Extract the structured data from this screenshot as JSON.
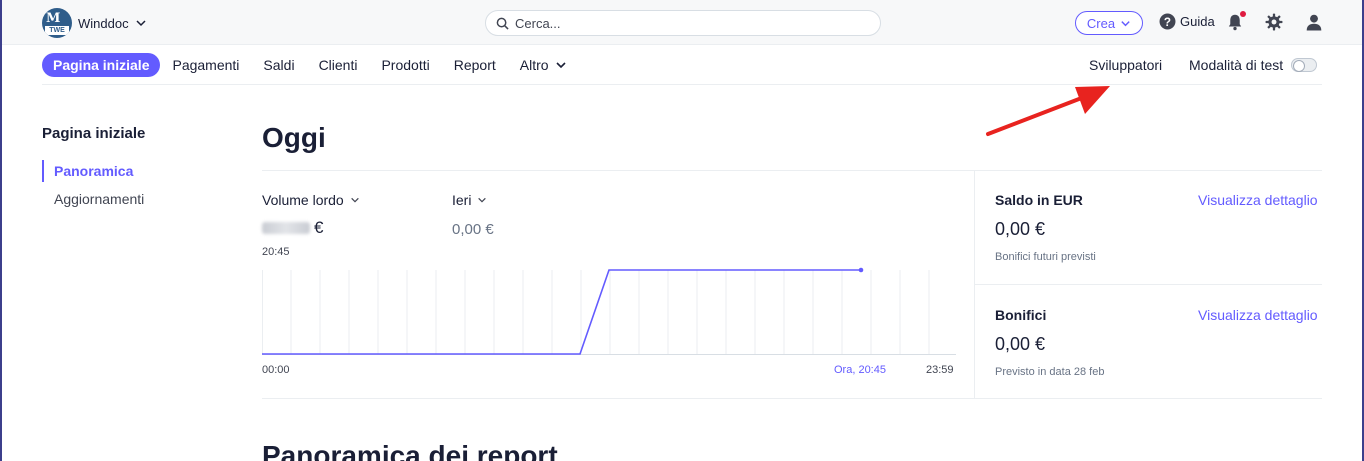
{
  "topbar": {
    "account_name": "Winddoc",
    "search_placeholder": "Cerca...",
    "create_label": "Crea",
    "help_label": "Guida",
    "icons": [
      "chevron-down-icon",
      "search-icon",
      "help-icon",
      "bell-icon",
      "gear-icon",
      "user-icon"
    ]
  },
  "nav": {
    "items": [
      {
        "label": "Pagina iniziale",
        "active": true
      },
      {
        "label": "Pagamenti"
      },
      {
        "label": "Saldi"
      },
      {
        "label": "Clienti"
      },
      {
        "label": "Prodotti"
      },
      {
        "label": "Report"
      },
      {
        "label": "Altro"
      }
    ],
    "developers_label": "Sviluppatori",
    "test_mode_label": "Modalità di test",
    "test_mode_on": false
  },
  "sidebar": {
    "title": "Pagina iniziale",
    "items": [
      {
        "label": "Panoramica",
        "active": true
      },
      {
        "label": "Aggiornamenti"
      }
    ]
  },
  "main": {
    "title": "Oggi",
    "metric_volume_label": "Volume lordo",
    "volume_currency": "€",
    "metric_ieri_label": "Ieri",
    "ieri_value": "0,00 €",
    "current_time": "20:45",
    "axis_start": "00:00",
    "axis_now": "Ora, 20:45",
    "axis_end": "23:59",
    "next_section_title": "Panoramica dei report"
  },
  "panels": {
    "saldo": {
      "title": "Saldo in EUR",
      "link": "Visualizza dettaglio",
      "value": "0,00 €",
      "sub": "Bonifici futuri previsti"
    },
    "bonifici": {
      "title": "Bonifici",
      "link": "Visualizza dettaglio",
      "value": "0,00 €",
      "sub": "Previsto in data 28 feb"
    }
  },
  "colors": {
    "accent": "#635bff",
    "text": "#1a1f36",
    "annotation_arrow": "#e8231f"
  }
}
